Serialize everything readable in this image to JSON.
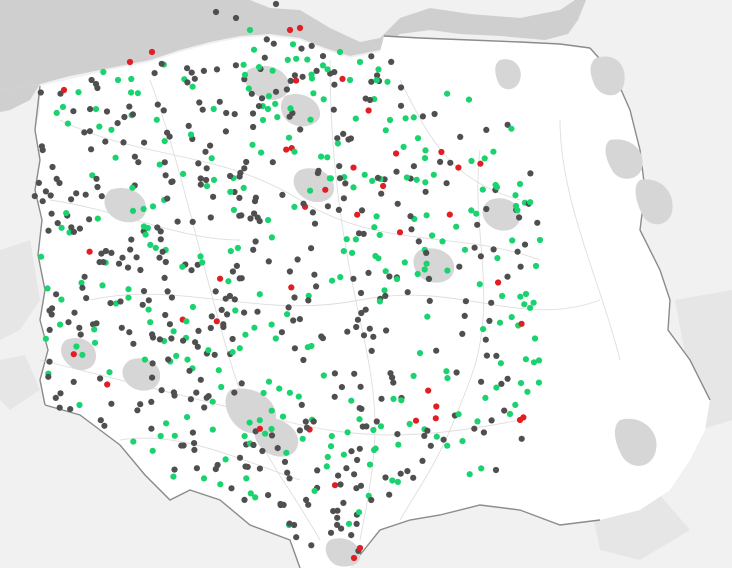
{
  "map": {
    "marker_colors": {
      "gray": "#4f4f4f",
      "green": "#19d36f",
      "red": "#e01e24"
    },
    "base_colors": {
      "land": "#ffffff",
      "outside": "#f1f1f1",
      "sea": "#cfcfcf",
      "lakes": "#d2d2d2",
      "urban": "#e2e2e2",
      "border": "#8b8b8b"
    }
  }
}
